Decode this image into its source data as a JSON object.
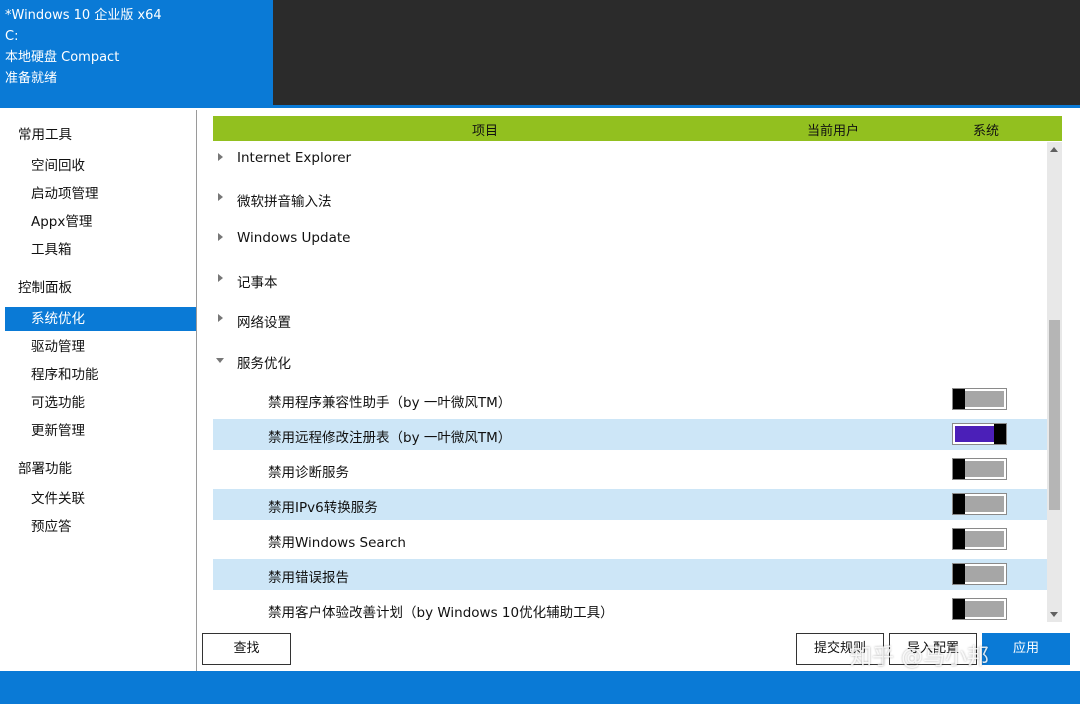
{
  "info": {
    "os": "*Windows 10 企业版 x64",
    "drive": "C:",
    "disk": "本地硬盘 Compact",
    "status": "准备就绪"
  },
  "sidebar": {
    "groups": [
      "常用工具",
      "控制面板",
      "部署功能"
    ],
    "items": [
      "空间回收",
      "启动项管理",
      "Appx管理",
      "工具箱",
      "系统优化",
      "驱动管理",
      "程序和功能",
      "可选功能",
      "更新管理",
      "文件关联",
      "预应答"
    ]
  },
  "table": {
    "headers": [
      "项目",
      "当前用户",
      "系统"
    ],
    "categories": [
      "Internet Explorer",
      "微软拼音输入法",
      "Windows Update",
      "记事本",
      "网络设置",
      "服务优化"
    ],
    "services": [
      {
        "label": "禁用程序兼容性助手（by 一叶微风TM）",
        "on": false
      },
      {
        "label": "禁用远程修改注册表（by 一叶微风TM）",
        "on": true
      },
      {
        "label": "禁用诊断服务",
        "on": false
      },
      {
        "label": "禁用IPv6转换服务",
        "on": false
      },
      {
        "label": "禁用Windows Search",
        "on": false
      },
      {
        "label": "禁用错误报告",
        "on": false
      },
      {
        "label": "禁用客户体验改善计划（by Windows 10优化辅助工具）",
        "on": false
      }
    ]
  },
  "buttons": {
    "find": "查找",
    "submit_rules": "提交规则",
    "import_config": "导入配置",
    "apply": "应用"
  },
  "watermark": "知乎 @马小邦"
}
